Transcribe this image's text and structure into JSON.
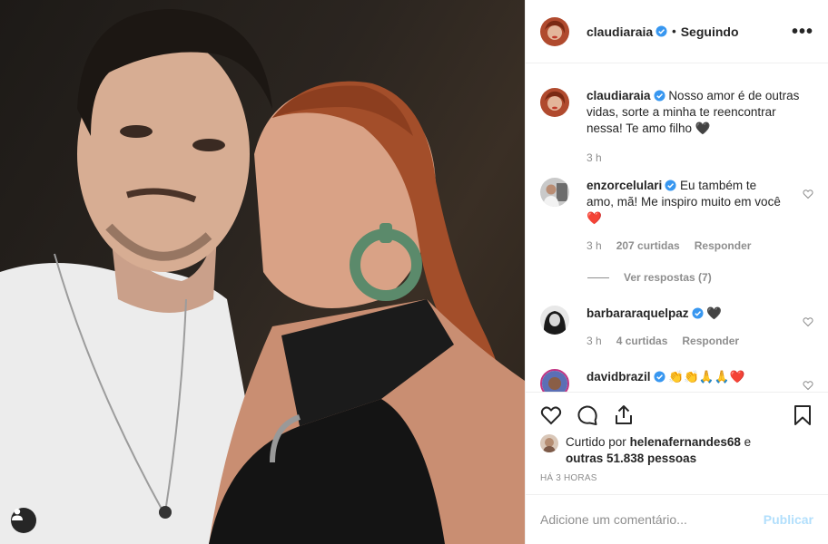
{
  "post": {
    "author": "claudiaraia",
    "dot": "•",
    "follow_label": "Seguindo",
    "more_label": "•••"
  },
  "comments": [
    {
      "user": "claudiaraia",
      "text": "Nosso amor é de outras vidas, sorte a minha te reencontrar nessa! Te amo filho",
      "emoji": "🖤",
      "time": "3 h"
    },
    {
      "user": "enzorcelulari",
      "text": "Eu também te amo, mã! Me inspiro muito em você",
      "emoji": "❤️",
      "time": "3 h",
      "likes": "207 curtidas",
      "reply": "Responder",
      "view_replies": "Ver respostas (7)"
    },
    {
      "user": "barbararaquelpaz",
      "text": "",
      "emoji": "🖤",
      "time": "3 h",
      "likes": "4 curtidas",
      "reply": "Responder"
    },
    {
      "user": "davidbrazil",
      "text": "",
      "emoji": "👏👏🙏🙏❤️"
    }
  ],
  "liked": {
    "prefix": "Curtido por",
    "user": "helenafernandes68",
    "connector": "e",
    "others": "outras 51.838 pessoas"
  },
  "timestamp": "HÁ 3 HORAS",
  "add_comment": {
    "placeholder": "Adicione um comentário...",
    "publish_label": "Publicar"
  },
  "colors": {
    "verified": "#3897f0",
    "publish": "#b2dffc",
    "meta": "#8e8e8e"
  }
}
